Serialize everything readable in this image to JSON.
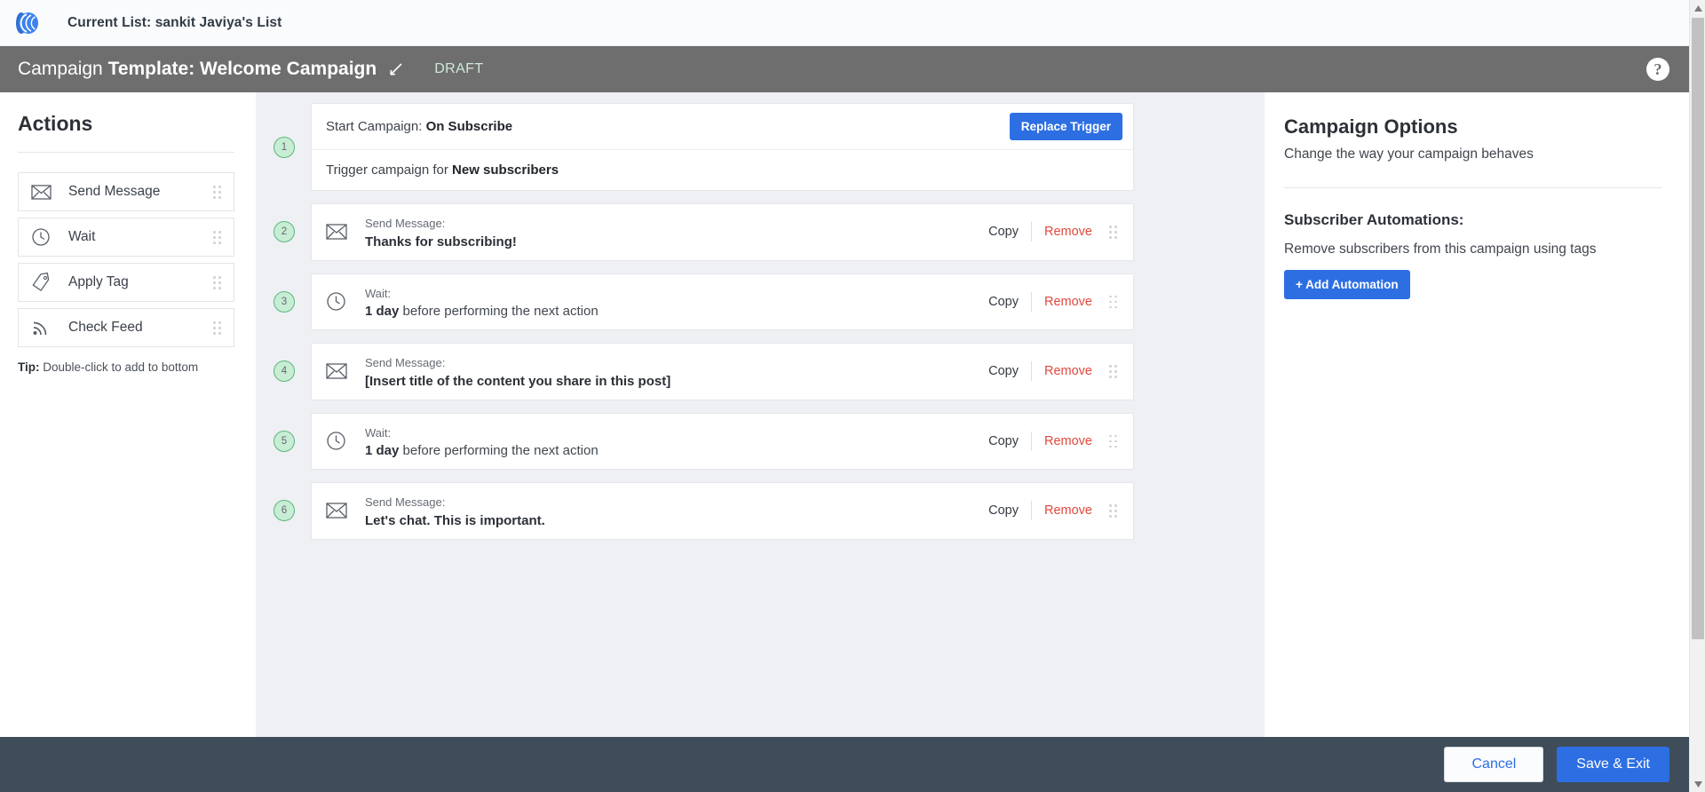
{
  "topbar": {
    "logo_icon": "brand-logo-icon",
    "current_list_label": "Current List: sankit Javiya's List"
  },
  "header": {
    "title_prefix": "Campaign ",
    "title_main": "Template: Welcome Campaign",
    "edit_icon": "pencil-icon",
    "status": "DRAFT",
    "help_icon": "?",
    "background_color": "#6e6e6e",
    "status_color": "#cfe8d8"
  },
  "sidebar": {
    "title": "Actions",
    "items": [
      {
        "label": "Send Message",
        "icon": "envelope-icon"
      },
      {
        "label": "Wait",
        "icon": "clock-icon"
      },
      {
        "label": "Apply Tag",
        "icon": "tag-icon"
      },
      {
        "label": "Check Feed",
        "icon": "rss-icon"
      }
    ],
    "tip_bold": "Tip:",
    "tip_text": " Double-click to add to bottom"
  },
  "steps": [
    {
      "number": "1",
      "type": "trigger",
      "top_label": "Start Campaign: ",
      "top_value": "On Subscribe",
      "button_label": "Replace Trigger",
      "body_label": "Trigger campaign for ",
      "body_value": "New subscribers"
    },
    {
      "number": "2",
      "type": "action",
      "icon": "envelope-icon",
      "kind": "Send Message:",
      "title_bold": "Thanks for subscribing!",
      "title_rest": "",
      "copy_label": "Copy",
      "remove_label": "Remove"
    },
    {
      "number": "3",
      "type": "action",
      "icon": "clock-icon",
      "kind": "Wait:",
      "title_bold": "1 day",
      "title_rest": " before performing the next action",
      "copy_label": "Copy",
      "remove_label": "Remove"
    },
    {
      "number": "4",
      "type": "action",
      "icon": "envelope-icon",
      "kind": "Send Message:",
      "title_bold": "[Insert title of the content you share in this post]",
      "title_rest": "",
      "copy_label": "Copy",
      "remove_label": "Remove"
    },
    {
      "number": "5",
      "type": "action",
      "icon": "clock-icon",
      "kind": "Wait:",
      "title_bold": "1 day",
      "title_rest": " before performing the next action",
      "copy_label": "Copy",
      "remove_label": "Remove"
    },
    {
      "number": "6",
      "type": "action",
      "icon": "envelope-icon",
      "kind": "Send Message:",
      "title_bold": "Let's chat. This is important.",
      "title_rest": "",
      "copy_label": "Copy",
      "remove_label": "Remove"
    }
  ],
  "right_panel": {
    "title": "Campaign Options",
    "subtitle": "Change the way your campaign behaves",
    "section_title": "Subscriber Automations:",
    "section_desc": "Remove subscribers from this campaign using tags",
    "add_button": "+ Add Automation"
  },
  "footer": {
    "cancel_label": "Cancel",
    "save_label": "Save & Exit",
    "background_color": "#3e4d59"
  },
  "colors": {
    "accent_blue": "#2d6fe3",
    "remove_red": "#e0483c",
    "badge_green_fill": "#c8edd5",
    "badge_green_border": "#5cb57e",
    "content_bg": "#eef0f3"
  }
}
